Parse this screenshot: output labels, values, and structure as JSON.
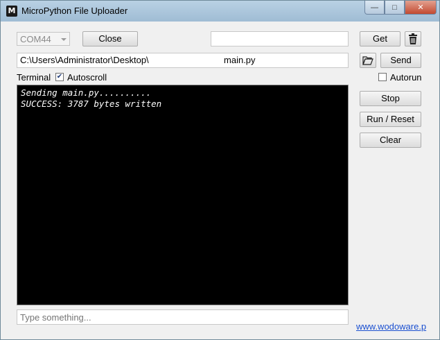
{
  "window": {
    "title": "MicroPython File Uploader",
    "app_icon_letter": "M",
    "minimize_glyph": "—",
    "maximize_glyph": "□",
    "close_glyph": "✕"
  },
  "toolbar": {
    "port_value": "COM44",
    "close_label": "Close",
    "remote_file_value": "",
    "get_label": "Get",
    "send_label": "Send"
  },
  "file_path": "C:\\Users\\Administrator\\Desktop\\                              main.py",
  "options": {
    "terminal_label": "Terminal",
    "autoscroll_label": "Autoscroll",
    "autoscroll_checked": true,
    "autorun_label": "Autorun",
    "autorun_checked": false
  },
  "side_buttons": {
    "stop": "Stop",
    "run_reset": "Run / Reset",
    "clear": "Clear"
  },
  "terminal_lines": [
    "Sending main.py..........",
    "SUCCESS: 3787 bytes written"
  ],
  "input": {
    "placeholder": "Type something...",
    "value": ""
  },
  "footer": {
    "link_text": "www.wodoware.p"
  },
  "icons": {
    "trash": "trash-icon",
    "folder": "folder-open-icon"
  }
}
